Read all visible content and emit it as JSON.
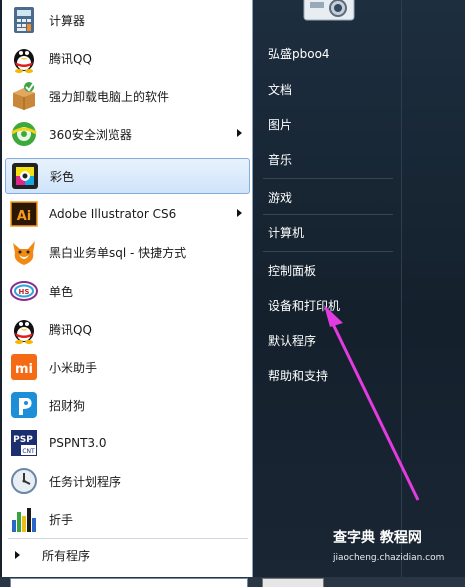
{
  "start_menu": {
    "programs": [
      {
        "label": "计算器",
        "icon": "calculator-icon"
      },
      {
        "label": "腾讯QQ",
        "icon": "qq-penguin-icon"
      },
      {
        "label": "强力卸载电脑上的软件",
        "icon": "uninstall-box-icon"
      },
      {
        "label": "360安全浏览器",
        "icon": "360-browser-icon",
        "has_submenu": true
      },
      {
        "label": "彩色",
        "icon": "color-printer-icon",
        "selected": true
      },
      {
        "label": "Adobe Illustrator CS6",
        "icon": "illustrator-icon",
        "has_submenu": true
      },
      {
        "label": "黑白业务单sql - 快捷方式",
        "icon": "fox-icon"
      },
      {
        "label": "单色",
        "icon": "mono-printer-icon"
      },
      {
        "label": "腾讯QQ",
        "icon": "qq-penguin-icon"
      },
      {
        "label": "小米助手",
        "icon": "mi-icon"
      },
      {
        "label": "招财狗",
        "icon": "dog-icon"
      },
      {
        "label": "PSPNT3.0",
        "icon": "pspnt-icon"
      },
      {
        "label": "任务计划程序",
        "icon": "clock-icon"
      },
      {
        "label": "折手",
        "icon": "chart-icon"
      }
    ],
    "all_programs": "所有程序",
    "right_items": [
      {
        "label": "弘盛pboo4"
      },
      {
        "label": "文档"
      },
      {
        "label": "图片"
      },
      {
        "label": "音乐"
      },
      {
        "label": "游戏"
      },
      {
        "label": "计算机"
      },
      {
        "label": "控制面板"
      },
      {
        "label": "设备和打印机"
      },
      {
        "label": "默认程序"
      },
      {
        "label": "帮助和支持"
      }
    ],
    "watermark_title": "查字典 教程网",
    "watermark_url": "jiaocheng.chazidian.com"
  },
  "colors": {
    "annotation_arrow": "#e23be0",
    "selected_highlight": "#cfe4fa",
    "right_panel": "#1d2e3f"
  }
}
